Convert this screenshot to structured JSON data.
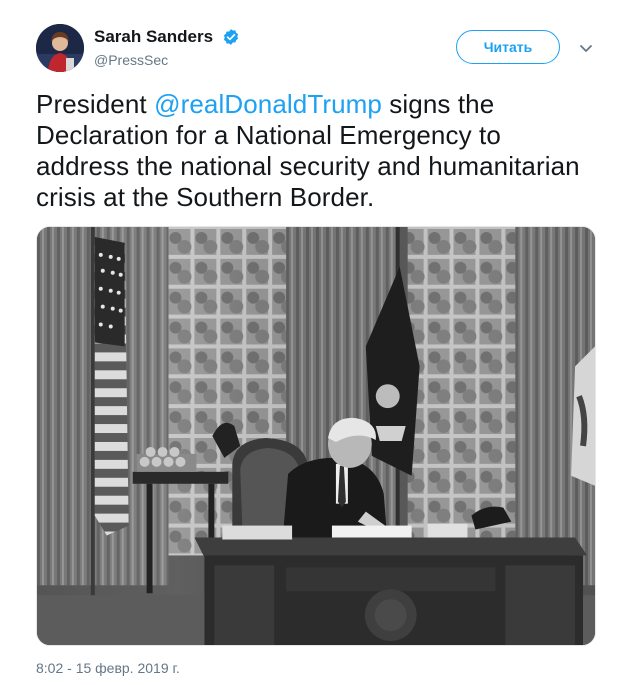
{
  "author": {
    "display_name": "Sarah Sanders",
    "handle": "@PressSec",
    "verified": true,
    "avatar_icon": "avatar-portrait"
  },
  "follow_button": {
    "label": "Читать"
  },
  "menu": {
    "icon": "chevron-down-icon"
  },
  "tweet": {
    "text_before": "President ",
    "mention": "@realDonaldTrump",
    "text_after": " signs the Declaration for a National Emergency to address the national security and humanitarian crisis at the Southern Border."
  },
  "media": {
    "type": "photo",
    "style": "black-and-white"
  },
  "timestamp": "8:02 - 15 февр. 2019 г.",
  "colors": {
    "accent": "#1da1f2",
    "text": "#14171a",
    "secondary": "#657786"
  }
}
